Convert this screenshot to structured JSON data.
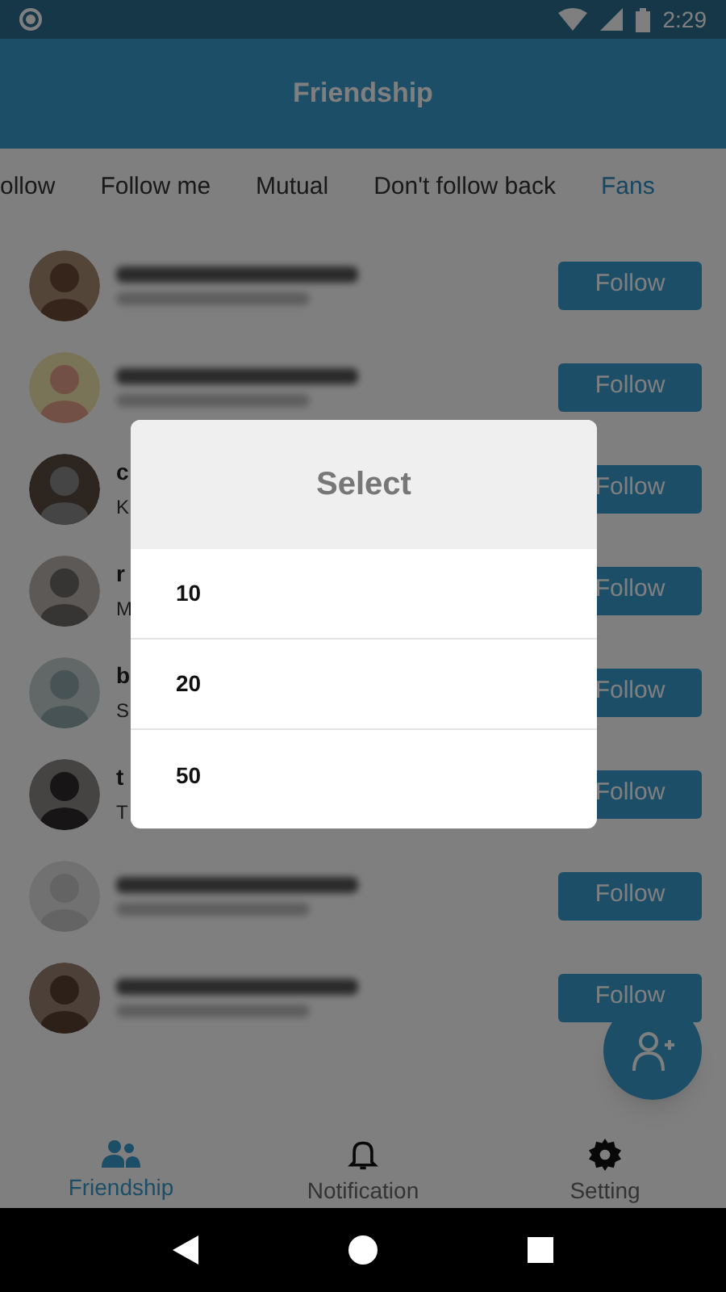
{
  "status_bar": {
    "time": "2:29"
  },
  "header": {
    "title": "Friendship"
  },
  "tabs": [
    {
      "label": "ollow",
      "selected": false
    },
    {
      "label": "Follow me",
      "selected": false
    },
    {
      "label": "Mutual",
      "selected": false
    },
    {
      "label": "Don't follow back",
      "selected": false
    },
    {
      "label": "Fans",
      "selected": true
    }
  ],
  "users": [
    {
      "kind": "blurred",
      "button": "Follow"
    },
    {
      "kind": "blurred",
      "button": "Follow"
    },
    {
      "kind": "partial",
      "name": "c",
      "subtitle": "K",
      "button": "Follow"
    },
    {
      "kind": "partial",
      "name": "r",
      "subtitle": "M",
      "button": "Follow"
    },
    {
      "kind": "partial",
      "name": "b",
      "subtitle": "S",
      "button": "Follow"
    },
    {
      "kind": "partial",
      "name": "t",
      "subtitle": "T",
      "button": "Follow"
    },
    {
      "kind": "blurred",
      "button": "Follow"
    },
    {
      "kind": "blurred",
      "button": "Follow"
    }
  ],
  "dialog": {
    "title": "Select",
    "options": [
      "10",
      "20",
      "50"
    ]
  },
  "bottom_nav": [
    {
      "label": "Friendship",
      "selected": true
    },
    {
      "label": "Notification",
      "selected": false
    },
    {
      "label": "Setting",
      "selected": false
    }
  ]
}
